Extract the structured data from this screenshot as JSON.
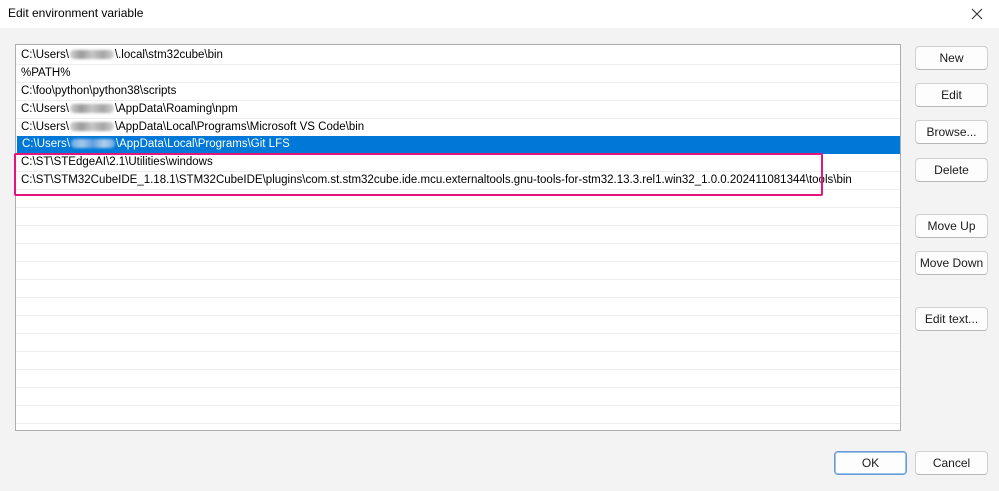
{
  "window": {
    "title": "Edit environment variable",
    "close_icon": "close-icon"
  },
  "list": {
    "items": [
      {
        "prefix": "C:\\Users\\",
        "redacted": true,
        "suffix": "\\.local\\stm32cube\\bin",
        "selected": false
      },
      {
        "prefix": "%PATH%",
        "redacted": false,
        "suffix": "",
        "selected": false
      },
      {
        "prefix": "C:\\foo\\python\\python38\\scripts",
        "redacted": false,
        "suffix": "",
        "selected": false
      },
      {
        "prefix": "C:\\Users\\",
        "redacted": true,
        "suffix": "\\AppData\\Roaming\\npm",
        "selected": false
      },
      {
        "prefix": "C:\\Users\\",
        "redacted": true,
        "suffix": "\\AppData\\Local\\Programs\\Microsoft VS Code\\bin",
        "selected": false
      },
      {
        "prefix": "C:\\Users\\",
        "redacted": true,
        "suffix": "\\AppData\\Local\\Programs\\Git LFS",
        "selected": true
      },
      {
        "prefix": "C:\\ST\\STEdgeAI\\2.1\\Utilities\\windows",
        "redacted": false,
        "suffix": "",
        "selected": false
      },
      {
        "prefix": "C:\\ST\\STM32CubeIDE_1.18.1\\STM32CubeIDE\\plugins\\com.st.stm32cube.ide.mcu.externaltools.gnu-tools-for-stm32.13.3.rel1.win32_1.0.0.202411081344\\tools\\bin",
        "redacted": false,
        "suffix": "",
        "selected": false
      }
    ],
    "empty_rows": 13,
    "selection_color": "#0078d7",
    "highlight_color": "#e4167b"
  },
  "buttons": {
    "new": "New",
    "edit": "Edit",
    "browse": "Browse...",
    "delete": "Delete",
    "move_up": "Move Up",
    "move_down": "Move Down",
    "edit_text": "Edit text...",
    "ok": "OK",
    "cancel": "Cancel"
  }
}
